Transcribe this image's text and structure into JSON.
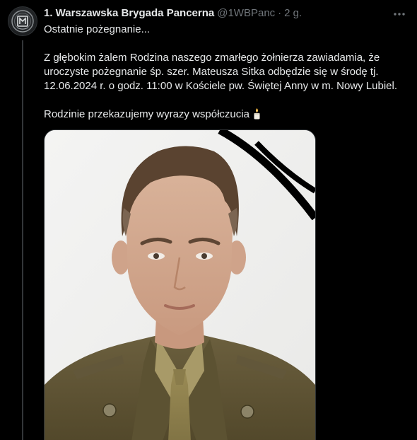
{
  "author": {
    "display_name": "1. Warszawska Brygada Pancerna",
    "handle": "@1WBPanc",
    "separator": "·",
    "time": "2 g."
  },
  "post": {
    "line1": "Ostatnie pożegnanie...",
    "line2": "Z głębokim żalem Rodzina naszego zmarłego żołnierza zawiadamia, że uroczyste pożegnanie śp. szer. Mateusza Sitka odbędzie się w środę tj. 12.06.2024 r. o godz. 11:00 w Kościele pw. Świętej Anny w m. Nowy Lubiel.",
    "line3": "Rodzinie przekazujemy wyrazy współczucia",
    "emoji": "candle-icon"
  },
  "icons": {
    "avatar": "brigade-emblem-icon",
    "more": "more-options-icon",
    "mourning_ribbon": "mourning-ribbon-icon"
  },
  "colors": {
    "background": "#000000",
    "text_primary": "#e7e9ea",
    "text_secondary": "#71767b",
    "border": "#2f3336"
  }
}
